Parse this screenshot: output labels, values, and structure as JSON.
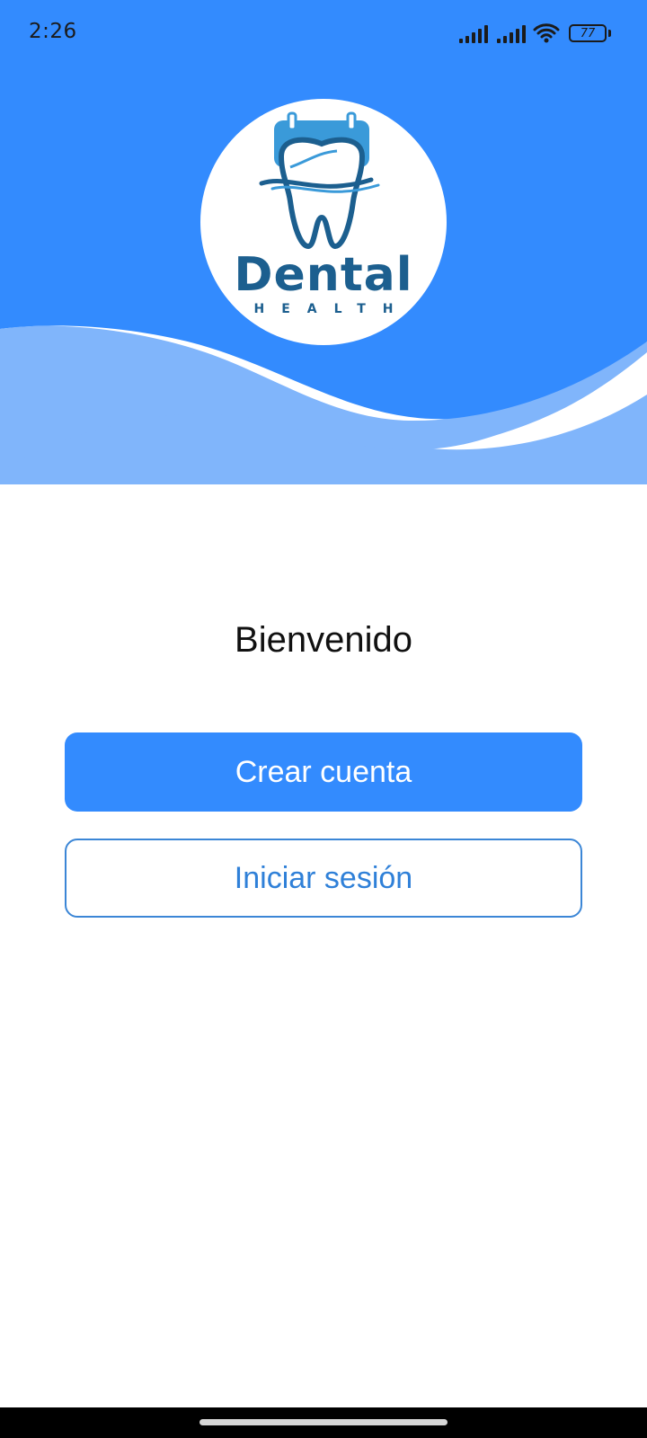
{
  "status_bar": {
    "time": "2:26",
    "battery_level": "77",
    "icons": [
      "signal-icon",
      "signal-icon",
      "wifi-icon",
      "battery-icon"
    ]
  },
  "logo": {
    "word": "Dental",
    "sub": "HEALTH"
  },
  "welcome": {
    "title": "Bienvenido"
  },
  "actions": {
    "create_account_label": "Crear cuenta",
    "login_label": "Iniciar sesión"
  },
  "colors": {
    "primary": "#338bfe",
    "wave_light": "#80b5fb",
    "logo_text": "#1c5f8f",
    "outline_button_text": "#2f80d8"
  }
}
